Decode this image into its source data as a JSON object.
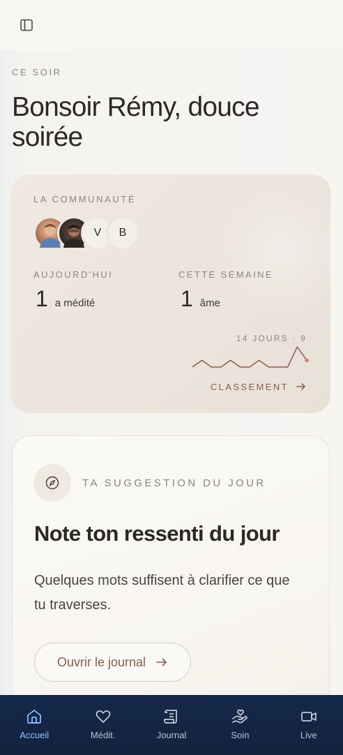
{
  "header": {
    "eyebrow": "CE SOIR",
    "greeting": "Bonsoir Rémy, douce soirée"
  },
  "community": {
    "label": "LA COMMUNAUTÉ",
    "avatars": [
      {
        "type": "photo",
        "name": "avatar-photo-1"
      },
      {
        "type": "photo",
        "name": "avatar-photo-2"
      },
      {
        "type": "initial",
        "initial": "V"
      },
      {
        "type": "initial",
        "initial": "B"
      }
    ],
    "today": {
      "label": "AUJOURD'HUI",
      "value": "1",
      "unit": "a médité"
    },
    "week": {
      "label": "CETTE SEMAINE",
      "value": "1",
      "unit": "âme"
    },
    "sparkline_caption": "14 JOURS · 9",
    "sparkline_values": [
      0,
      1,
      0,
      0,
      1,
      0,
      0,
      1,
      0,
      0,
      0,
      3,
      1
    ],
    "classement_label": "CLASSEMENT"
  },
  "suggestion": {
    "eyebrow": "TA SUGGESTION DU JOUR",
    "title": "Note ton ressenti du jour",
    "description": "Quelques mots suffisent à clarifier ce que tu traverses.",
    "cta_label": "Ouvrir le journal"
  },
  "nav": {
    "items": [
      {
        "label": "Accueil",
        "icon": "home-icon",
        "active": true
      },
      {
        "label": "Médit.",
        "icon": "heart-icon",
        "active": false
      },
      {
        "label": "Journal",
        "icon": "scroll-icon",
        "active": false
      },
      {
        "label": "Soin",
        "icon": "hand-heart-icon",
        "active": false
      },
      {
        "label": "Live",
        "icon": "video-icon",
        "active": false
      }
    ]
  },
  "colors": {
    "accent": "#8a5e45",
    "nav_bg": "#16294a",
    "nav_active": "#8ec3ff"
  }
}
